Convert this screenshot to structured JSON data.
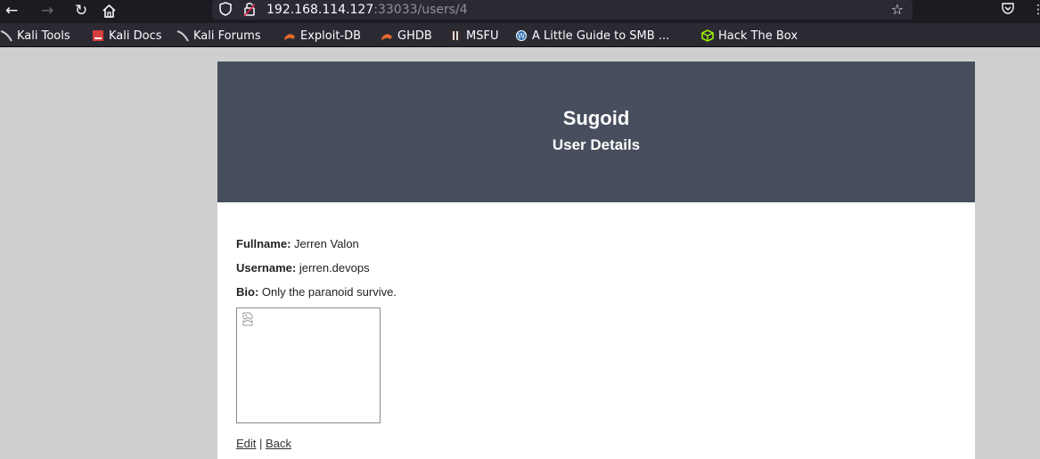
{
  "browser": {
    "url_host": "192.168.114.127",
    "url_rest": ":33033/users/4",
    "icons": {
      "back": "back-arrow-icon",
      "forward": "forward-arrow-icon",
      "reload": "reload-icon",
      "home": "home-icon",
      "shield": "tracking-shield-icon",
      "lock": "insecure-lock-icon",
      "star": "bookmark-star-icon",
      "pocket": "pocket-icon"
    }
  },
  "bookmarks": [
    {
      "label": "Kali Tools",
      "icon": "kali-dragon-icon"
    },
    {
      "label": "Kali Docs",
      "icon": "kali-docs-icon"
    },
    {
      "label": "Kali Forums",
      "icon": "kali-dragon-icon"
    },
    {
      "label": "Exploit-DB",
      "icon": "exploit-db-icon"
    },
    {
      "label": "GHDB",
      "icon": "ghdb-icon"
    },
    {
      "label": "MSFU",
      "icon": "msfu-icon"
    },
    {
      "label": "A Little Guide to SMB ...",
      "icon": "wordpress-icon"
    },
    {
      "label": "Hack The Box",
      "icon": "hack-the-box-icon"
    }
  ],
  "page": {
    "site_title": "Sugoid",
    "subtitle": "User Details",
    "fullname_label": "Fullname:",
    "fullname_value": "Jerren Valon",
    "username_label": "Username:",
    "username_value": "jerren.devops",
    "bio_label": "Bio:",
    "bio_value": "Only the paranoid survive.",
    "edit_link": "Edit",
    "separator": "|",
    "back_link": "Back"
  },
  "colors": {
    "header_bg": "#474e5d",
    "page_bg": "#cfcfcf",
    "chrome_bg": "#1c1b22",
    "bookmarks_bg": "#2b2a33"
  }
}
